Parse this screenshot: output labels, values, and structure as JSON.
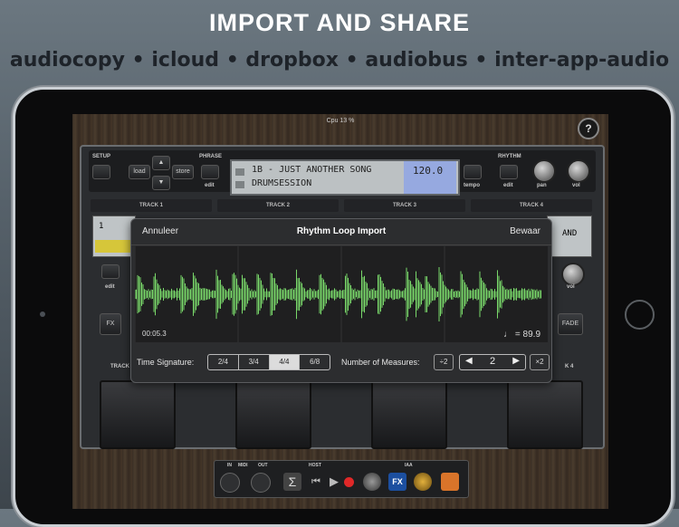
{
  "marketing": {
    "headline": "IMPORT AND SHARE",
    "subline": "audiocopy • icloud • dropbox • audiobus • inter-app-audio"
  },
  "app": {
    "cpu": "Cpu 13 %",
    "help_label": "?",
    "setup_label": "SETUP",
    "load_label": "load",
    "store_label": "store",
    "phrase_label": "PHRASE",
    "phrase_edit": "edit",
    "lcd_line1": "1B - JUST ANOTHER SONG",
    "lcd_line2": "DRUMSESSION",
    "lcd_tempo": "120.0",
    "rhythm_label": "RHYTHM",
    "tempo_label": "tempo",
    "rhythm_edit": "edit",
    "pan_label": "pan",
    "vol_label": "vol",
    "tracks": [
      "TRACK 1",
      "TRACK 2",
      "TRACK 3",
      "TRACK 4"
    ],
    "track1_num": "1",
    "track1_edit": "edit",
    "track4_lcd": "AND",
    "track4_vol": "vol",
    "fx_label": "FX",
    "fade_label": "FADE",
    "track_fragment": "TRACK",
    "track_fragment_right": "K 4"
  },
  "dialog": {
    "cancel": "Annuleer",
    "title": "Rhythm Loop Import",
    "save": "Bewaar",
    "time": "00:05.3",
    "bpm": "♩ = 89.9",
    "time_signature_label": "Time Signature:",
    "signatures": [
      "2/4",
      "3/4",
      "4/4",
      "6/8"
    ],
    "selected_signature": "4/4",
    "measures_label": "Number of Measures:",
    "div2": "÷2",
    "measures_value": "2",
    "mul2": "×2",
    "stepper_left": "◀",
    "stepper_right": "▶"
  },
  "bottombar": {
    "in_label": "IN",
    "midi_label": "MIDI",
    "out_label": "OUT",
    "host_label": "HOST",
    "iaa_label": "IAA"
  },
  "colors": {
    "waveform": "#79d86a",
    "lcd_bg": "#bcc1c3",
    "tempo_bg": "#96a9e0",
    "track_lcd": "#d6c63a",
    "record": "#e02828"
  }
}
